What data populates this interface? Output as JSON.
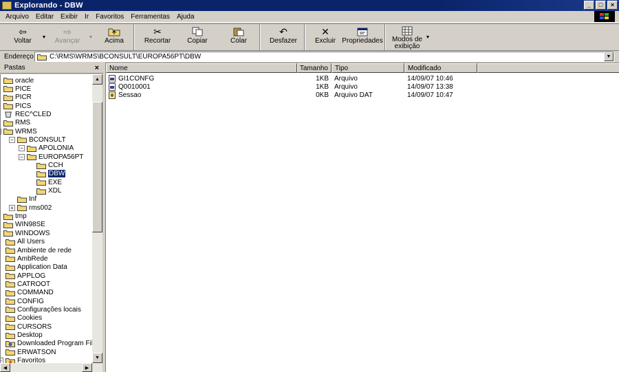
{
  "window": {
    "title": "Explorando - DBW",
    "btn_min": "_",
    "btn_max": "□",
    "btn_close": "×"
  },
  "menu": [
    "Arquivo",
    "Editar",
    "Exibir",
    "Ir",
    "Favoritos",
    "Ferramentas",
    "Ajuda"
  ],
  "toolbar": {
    "back": "Voltar",
    "forward": "Avançar",
    "up": "Acima",
    "cut": "Recortar",
    "copy": "Copiar",
    "paste": "Colar",
    "undo": "Desfazer",
    "delete": "Excluir",
    "properties": "Propriedades",
    "views": "Modos de exibição"
  },
  "address": {
    "label": "Endereço",
    "value": "C:\\RMS\\WRMS\\BCONSULT\\EUROPA56PT\\DBW"
  },
  "folders_pane": {
    "title": "Pastas",
    "close": "×"
  },
  "tree": [
    "oracle",
    "PICE",
    "PICR",
    "PICS",
    "REC^CLED",
    "RMS",
    "WRMS",
    "BCONSULT",
    "APOLONIA",
    "EUROPA56PT",
    "CCH",
    "DBW",
    "EXE",
    "XDL",
    "Inf",
    "rms002",
    "tmp",
    "WIN98SE",
    "WINDOWS",
    "All Users",
    "Ambiente de rede",
    "AmbRede",
    "Application Data",
    "APPLOG",
    "CATROOT",
    "COMMAND",
    "CONFIG",
    "Configurações locais",
    "Cookies",
    "CURSORS",
    "Desktop",
    "Downloaded Program Files",
    "ERWATSON",
    "Favoritos"
  ],
  "columns": {
    "name": "Nome",
    "size": "Tamanho",
    "type": "Tipo",
    "modified": "Modificado"
  },
  "files": [
    {
      "name": "GI1CONFG",
      "size": "1KB",
      "type": "Arquivo",
      "modified": "14/09/07 10:46"
    },
    {
      "name": "Q0010001",
      "size": "1KB",
      "type": "Arquivo",
      "modified": "14/09/07 13:38"
    },
    {
      "name": "Sessao",
      "size": "0KB",
      "type": "Arquivo DAT",
      "modified": "14/09/07 10:47"
    }
  ],
  "colors": {
    "titlebar": "#0a246a",
    "face": "#d4d0c8",
    "selection": "#0a246a",
    "folder": "#f2d674"
  }
}
